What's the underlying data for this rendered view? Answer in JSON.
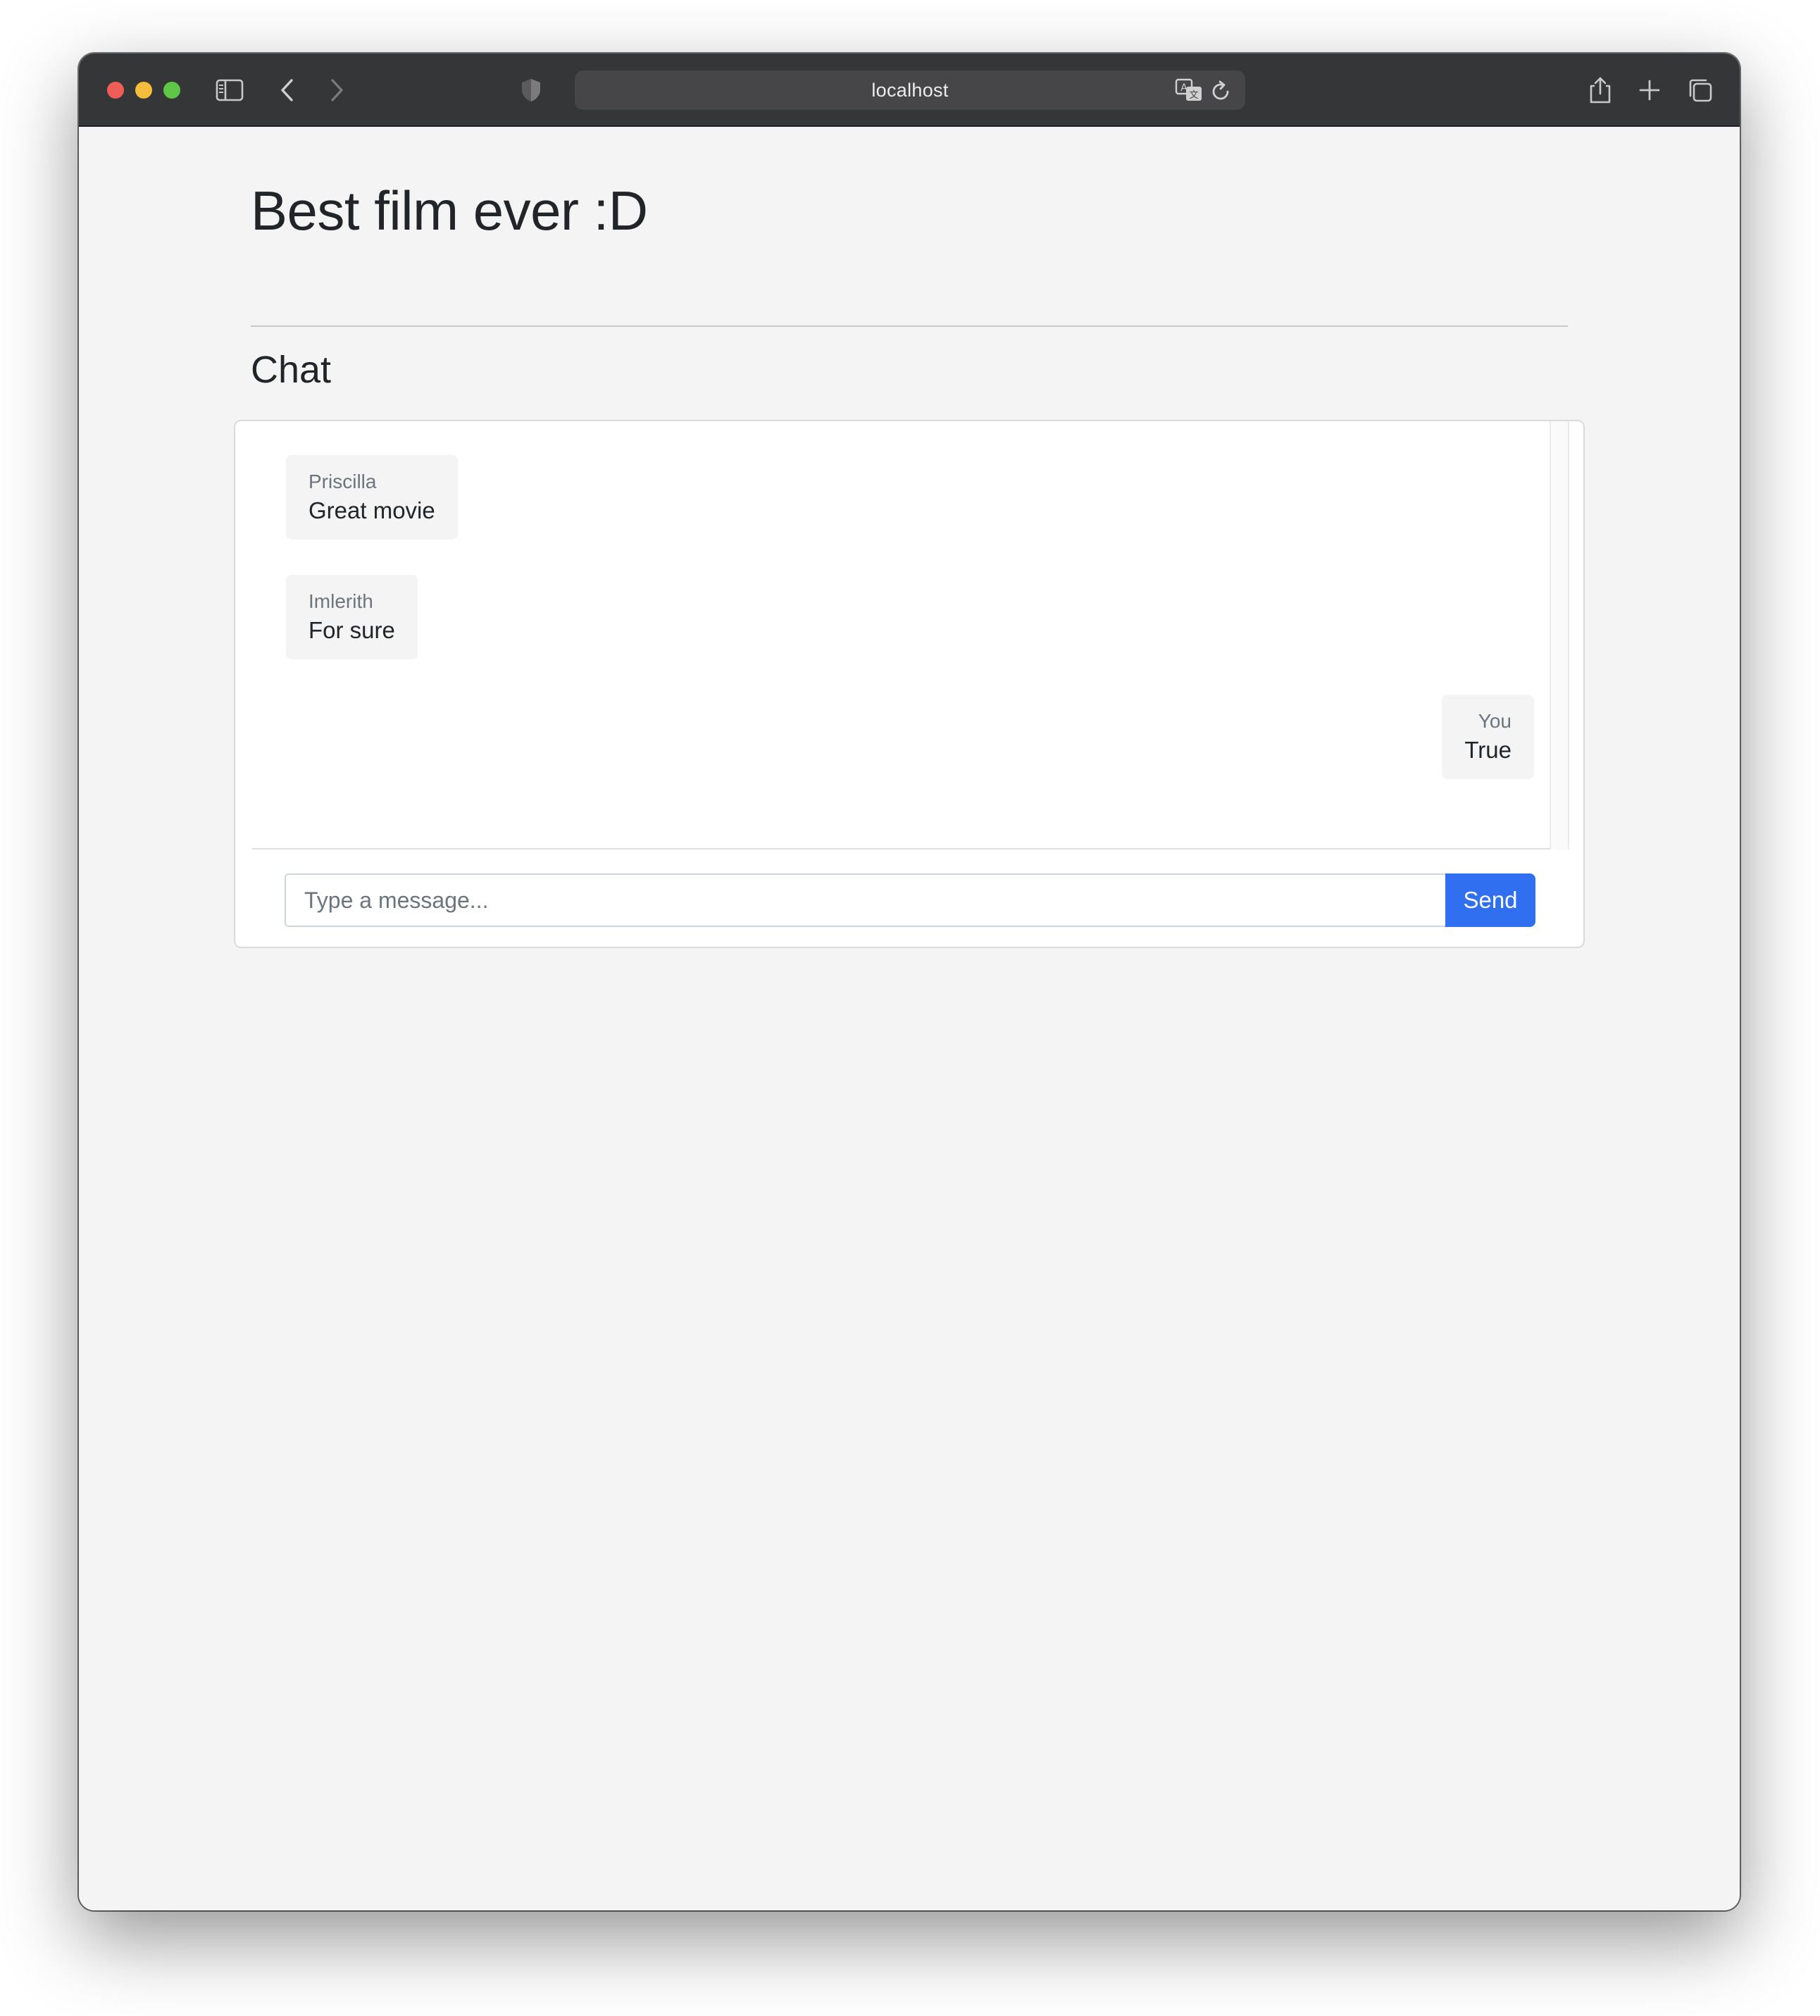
{
  "browser": {
    "url": "localhost",
    "icons": {
      "sidebar": "sidebar-icon",
      "back": "chevron-left-icon",
      "forward": "chevron-right-icon",
      "privacy": "shield-icon",
      "translate": "translate-icon",
      "reload": "reload-icon",
      "share": "share-icon",
      "new_tab": "plus-icon",
      "tabs": "tabs-overview-icon"
    },
    "colors": {
      "close": "#ee5e57",
      "minimize": "#f4bd3c",
      "zoom": "#5fc748"
    }
  },
  "page": {
    "title": "Best film ever :D",
    "section_title": "Chat"
  },
  "chat": {
    "messages": [
      {
        "sender": "Priscilla",
        "text": "Great movie",
        "own": false
      },
      {
        "sender": "Imlerith",
        "text": "For sure",
        "own": false
      },
      {
        "sender": "You",
        "text": "True",
        "own": true
      }
    ],
    "input": {
      "placeholder": "Type a message...",
      "value": ""
    },
    "send_label": "Send",
    "accent_color": "#2f6ff0"
  }
}
